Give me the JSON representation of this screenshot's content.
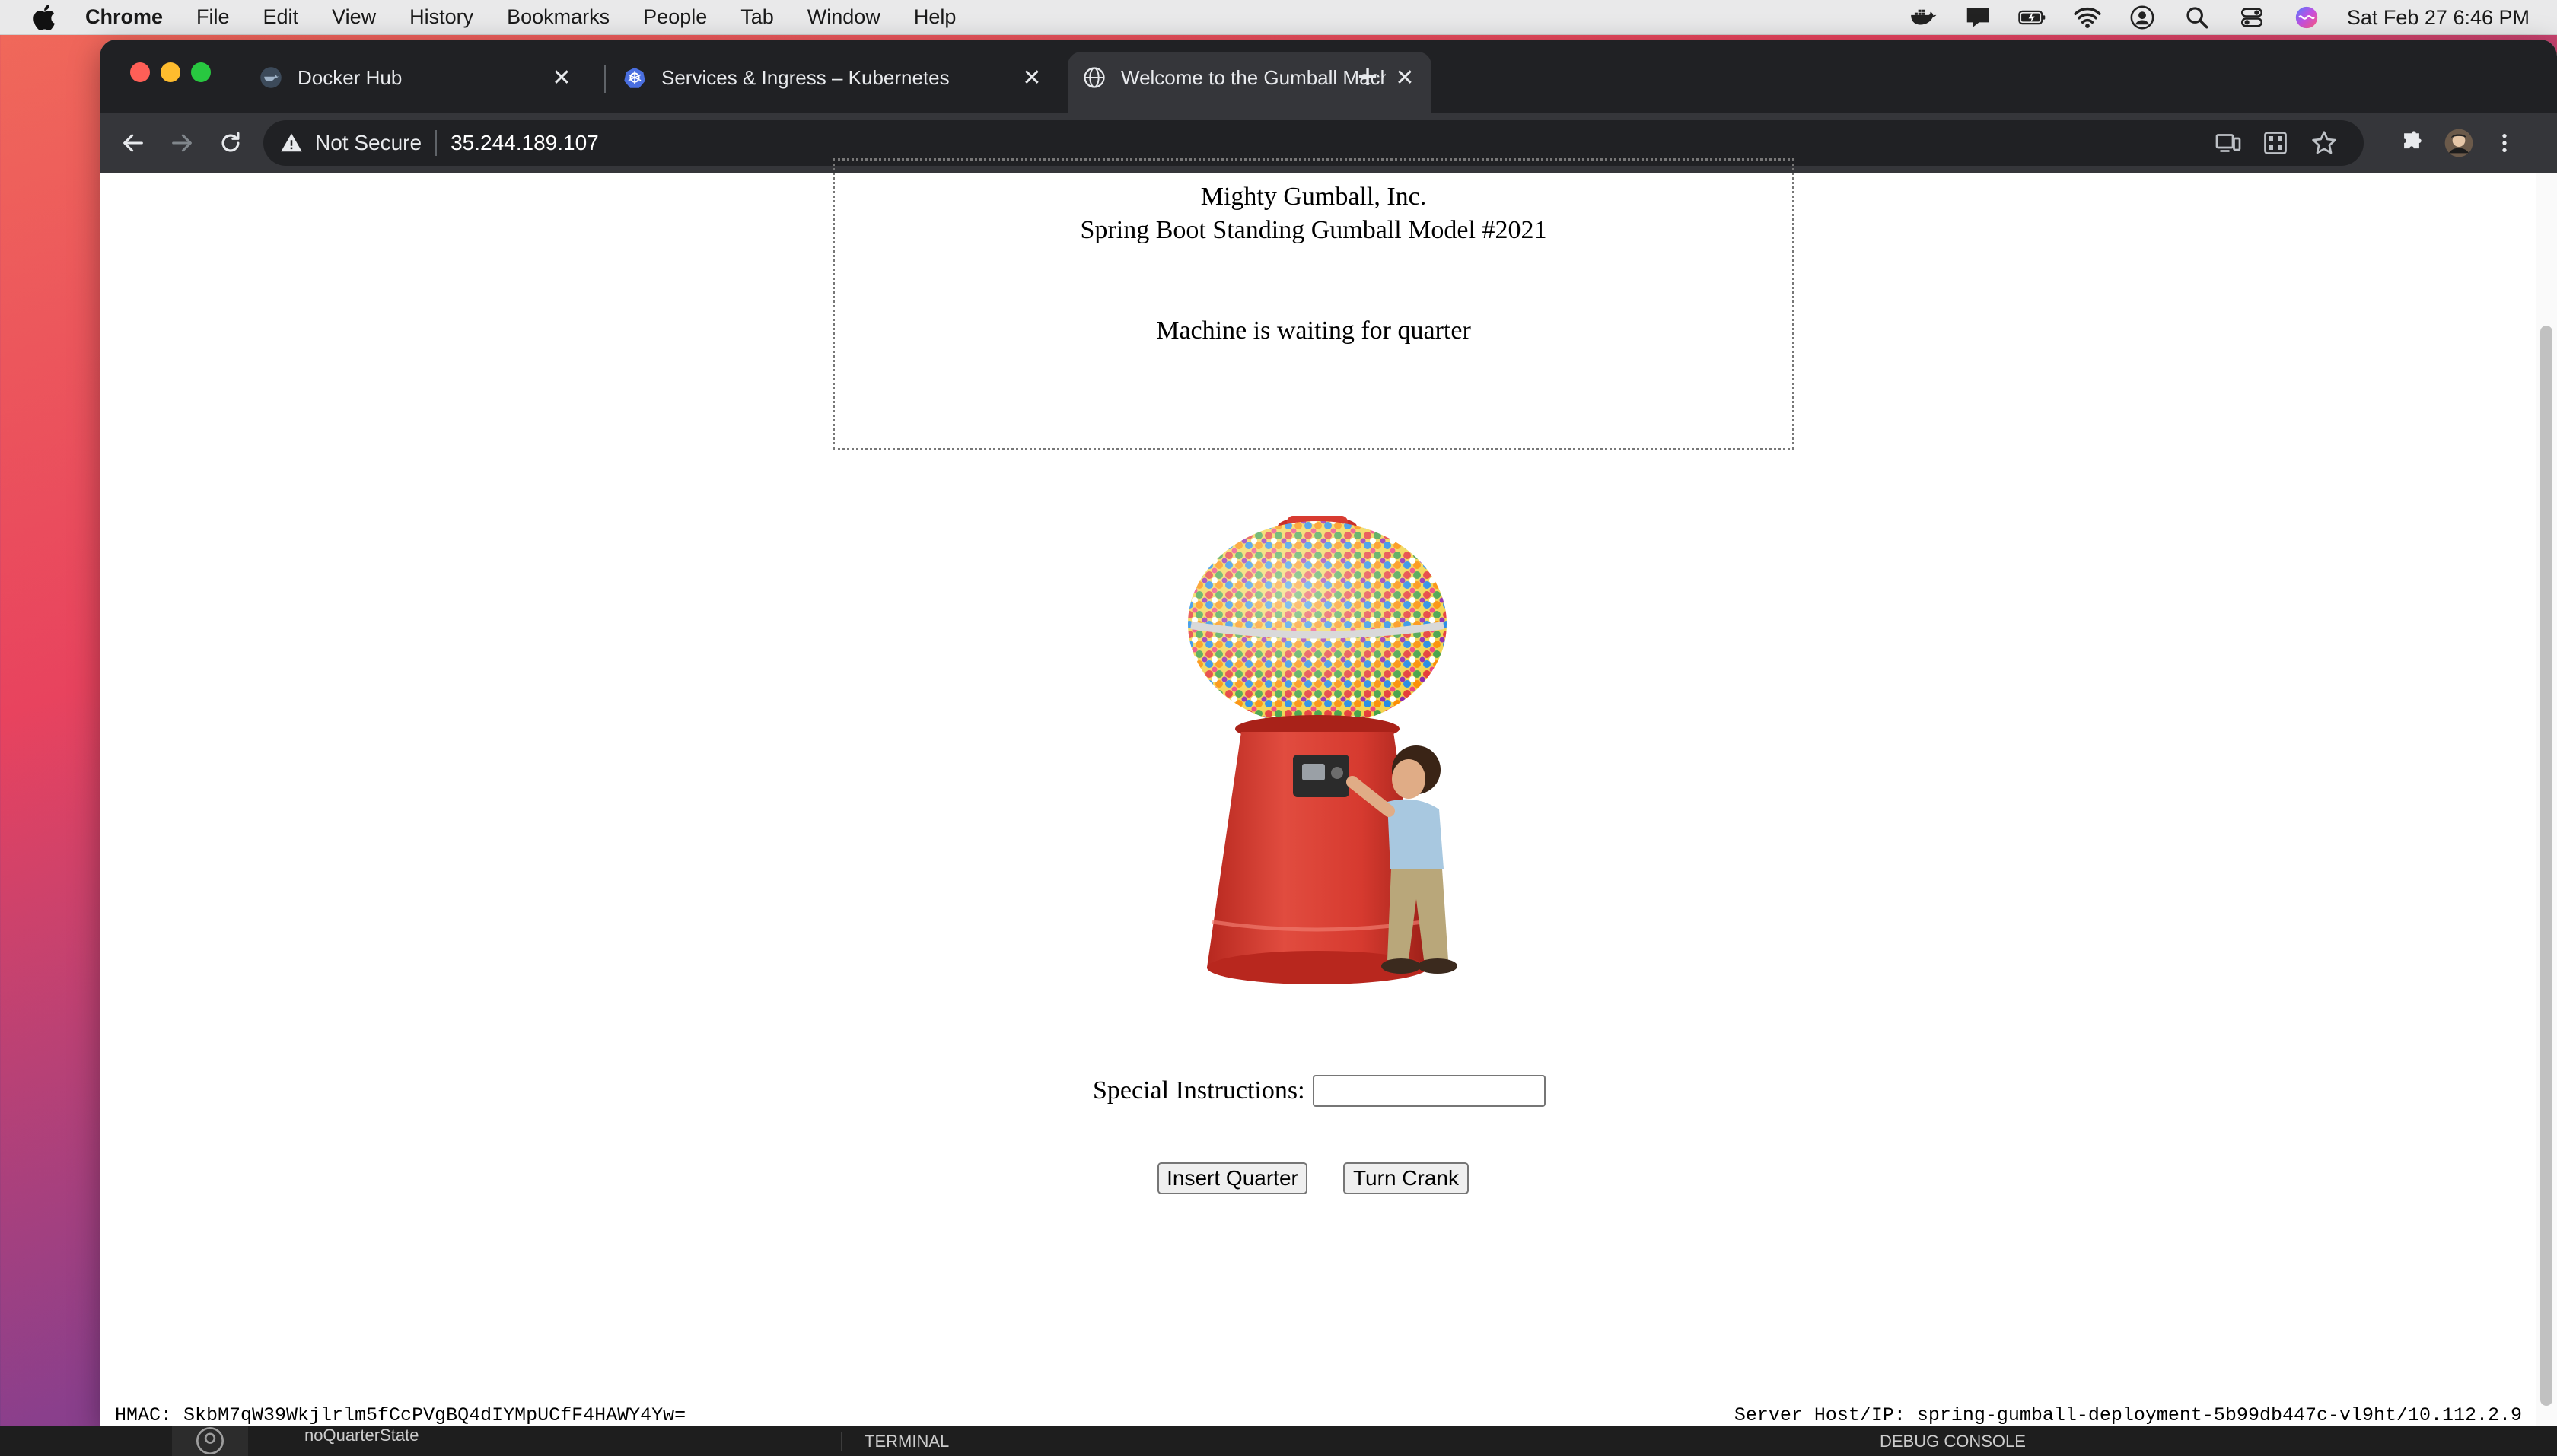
{
  "menubar": {
    "app_name": "Chrome",
    "menus": [
      "File",
      "Edit",
      "View",
      "History",
      "Bookmarks",
      "People",
      "Tab",
      "Window",
      "Help"
    ],
    "clock": "Sat Feb 27  6:46 PM"
  },
  "browser": {
    "tabs": [
      {
        "title": "Docker Hub",
        "active": false
      },
      {
        "title": "Services & Ingress – Kubernetes",
        "active": false
      },
      {
        "title": "Welcome to the Gumball Machine",
        "active": true
      }
    ],
    "security_label": "Not Secure",
    "url": "35.244.189.107"
  },
  "page": {
    "company": "Mighty Gumball, Inc.",
    "model": "Spring Boot Standing Gumball Model #2021",
    "machine_state": "Machine is waiting for quarter",
    "instructions_label": "Special Instructions:",
    "instructions_value": "",
    "insert_quarter_label": "Insert Quarter",
    "turn_crank_label": "Turn Crank",
    "hmac_text": "HMAC: SkbM7qW39Wkjlrlm5fCcPVgBQ4dIYMpUCfF4HAWY4Yw=",
    "server_text": "Server Host/IP:  spring-gumball-deployment-5b99db447c-vl9ht/10.112.2.9"
  },
  "background_editor": {
    "outline_item": "noQuarterState",
    "terminal_label": "TERMINAL",
    "debug_label": "DEBUG CONSOLE"
  },
  "colors": {
    "hmac_underline": "#e8392b",
    "machine_red": "#d63a2f",
    "tab_strip": "#202124",
    "toolbar": "#35363a"
  },
  "icons": [
    "apple-icon",
    "docker-icon",
    "kubernetes-icon",
    "globe-icon",
    "warning-icon",
    "star-icon",
    "extensions-icon"
  ]
}
